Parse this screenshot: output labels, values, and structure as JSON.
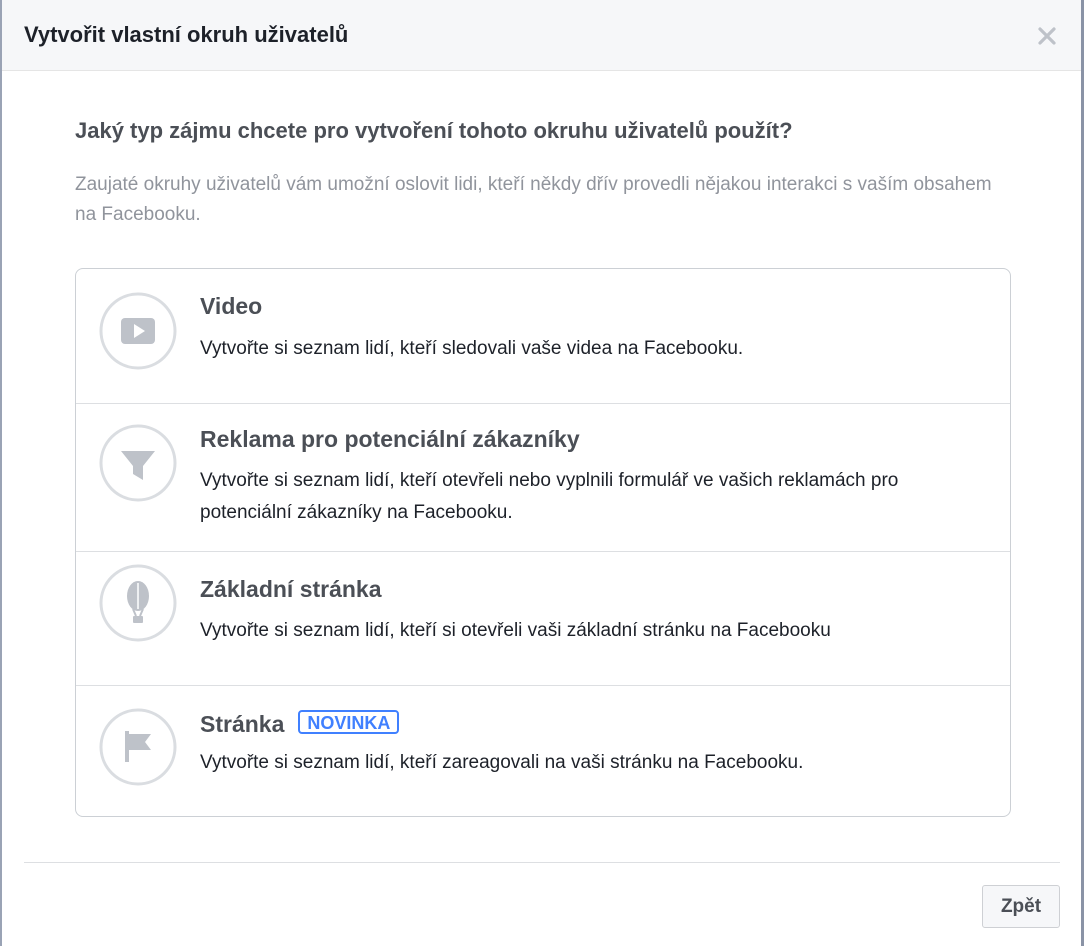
{
  "dialog": {
    "title": "Vytvořit vlastní okruh uživatelů",
    "close_icon": "close-icon"
  },
  "main": {
    "question": "Jaký typ zájmu chcete pro vytvoření tohoto okruhu uživatelů použít?",
    "description": "Zaujaté okruhy uživatelů vám umožní oslovit lidi, kteří někdy dřív provedli nějakou interakci s vaším obsahem na Facebooku."
  },
  "options": [
    {
      "icon": "video-play-icon",
      "title": "Video",
      "description": "Vytvořte si seznam lidí, kteří sledovali vaše videa na Facebooku."
    },
    {
      "icon": "funnel-icon",
      "title": "Reklama pro potenciální zákazníky",
      "description": "Vytvořte si seznam lidí, kteří otevřeli nebo vyplnili formulář ve vašich reklamách pro potenciální zákazníky na Facebooku."
    },
    {
      "icon": "balloon-icon",
      "title": "Základní stránka",
      "description": "Vytvořte si seznam lidí, kteří si otevřeli vaši základní stránku na Facebooku"
    },
    {
      "icon": "flag-icon",
      "title": "Stránka",
      "badge": "NOVINKA",
      "description": "Vytvořte si seznam lidí, kteří zareagovali na vaši stránku na Facebooku."
    }
  ],
  "footer": {
    "back_label": "Zpět"
  },
  "colors": {
    "header_bg": "#f6f7f9",
    "title_text": "#1d2129",
    "muted_text": "#90949c",
    "icon_gray": "#bec2c9",
    "badge_blue": "#4080ff",
    "border": "#ccd0d5"
  }
}
